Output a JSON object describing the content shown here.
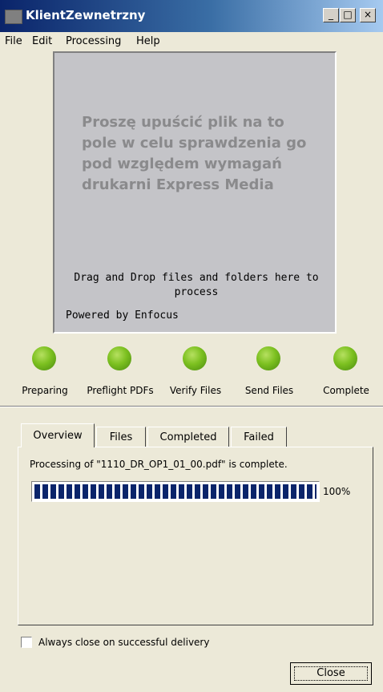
{
  "window": {
    "title": "KlientZewnetrzny",
    "minimize_glyph": "_",
    "maximize_glyph": "□",
    "close_glyph": "×"
  },
  "menu": {
    "items": [
      {
        "label": "File"
      },
      {
        "label": "Edit"
      },
      {
        "label": "Processing"
      },
      {
        "label": "Help"
      }
    ]
  },
  "dropzone": {
    "polish_text": "Proszę upuścić plik na to pole w celu sprawdzenia go pod względem wymagań drukarni Express Media",
    "hint": "Drag and Drop files and folders here to process",
    "powered_by": "Powered by Enfocus"
  },
  "status_steps": [
    {
      "label": "Preparing",
      "state": "complete",
      "color": "#7cc020"
    },
    {
      "label": "Preflight PDFs",
      "state": "complete",
      "color": "#7cc020"
    },
    {
      "label": "Verify Files",
      "state": "complete",
      "color": "#7cc020"
    },
    {
      "label": "Send Files",
      "state": "complete",
      "color": "#7cc020"
    },
    {
      "label": "Complete",
      "state": "complete",
      "color": "#7cc020"
    }
  ],
  "tabs": [
    {
      "label": "Overview",
      "active": true
    },
    {
      "label": "Files",
      "active": false
    },
    {
      "label": "Completed",
      "active": false
    },
    {
      "label": "Failed",
      "active": false
    }
  ],
  "overview": {
    "message": "Processing of \"1110_DR_OP1_01_00.pdf\" is complete.",
    "progress": 100,
    "progress_label": "100%"
  },
  "footer": {
    "checkbox_label": "Always close on successful delivery",
    "checkbox_checked": false,
    "close_label": "Close"
  },
  "colors": {
    "titlebar_start": "#0a246a",
    "progress_fill": "#0a246a",
    "status_green": "#7cc020"
  }
}
